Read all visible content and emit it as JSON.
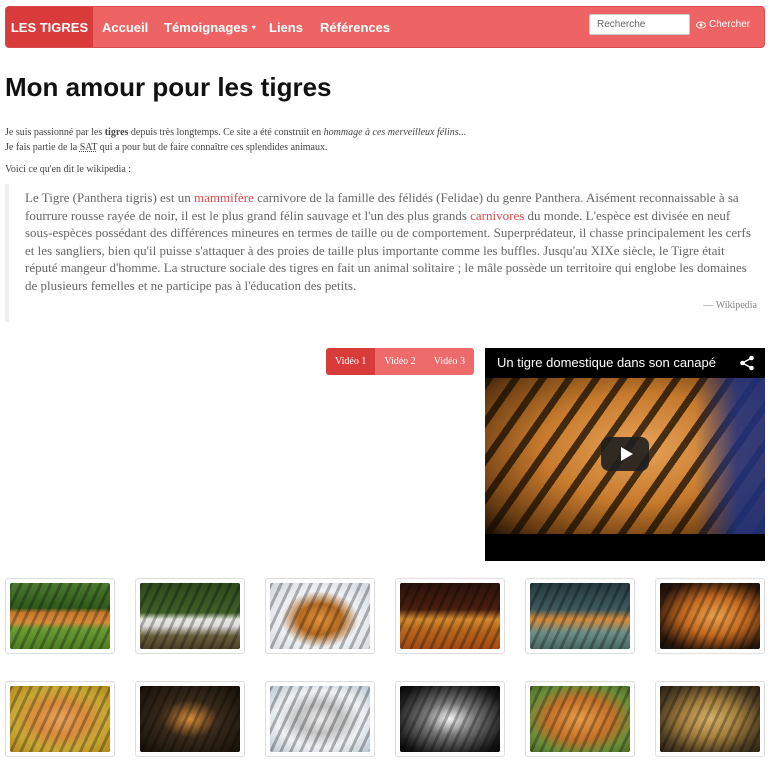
{
  "navbar": {
    "brand": "LES TIGRES",
    "items": [
      {
        "label": "Accueil"
      },
      {
        "label": "Témoignages"
      },
      {
        "label": "Liens"
      },
      {
        "label": "Références"
      }
    ],
    "caret": "▾",
    "search_placeholder": "Recherche",
    "search_button": "Chercher",
    "colors": {
      "bar": "#ee6363",
      "brand": "#d93a3a"
    }
  },
  "page_title": "Mon amour pour les tigres",
  "intro": {
    "line1_a": "Je suis passionné par les ",
    "line1_bold": "tigres",
    "line1_b": " depuis très longtemps. Ce site a été construit en ",
    "line1_italic": "hommage à ces merveilleux félins",
    "line1_c": "...",
    "line2_a": "Je fais partie de la ",
    "line2_abbr": "SAT",
    "line2_b": " qui a pour but de faire connaître ces splendides animaux.",
    "line3": "Voici ce qu'en dit le wikipedia :"
  },
  "quote": {
    "p1": "Le Tigre (Panthera tigris) est un ",
    "link1": "mammifère",
    "p2": " carnivore de la famille des félidés (Felidae) du genre Panthera. Aisément reconnaissable à sa fourrure rousse rayée de noir, il est le plus grand félin sauvage et l'un des plus grands ",
    "link2": "carnivores",
    "p3": " du monde. L'espèce est divisée en neuf sous-espèces possédant des différences mineures en termes de taille ou de comportement. Superprédateur, il chasse principalement les cerfs et les sangliers, bien qu'il puisse s'attaquer à des proies de taille plus importante comme les buffles. Jusqu'au XIXe siècle, le Tigre était réputé mangeur d'homme. La structure sociale des tigres en fait un animal solitaire ; le mâle possède un territoire qui englobe les domaines de plusieurs femelles et ne participe pas à l'éducation des petits.",
    "source": "— Wikipedia"
  },
  "video_tabs": [
    {
      "label": "Vidéo 1",
      "active": true
    },
    {
      "label": "Vidéo 2",
      "active": false
    },
    {
      "label": "Vidéo 3",
      "active": false
    }
  ],
  "video": {
    "title": "Un tigre domestique dans son canapé",
    "share_icon": "share-icon",
    "play_icon": "play-icon"
  },
  "gallery": {
    "rows": 2,
    "per_row": 6,
    "images": [
      "tiger-grass",
      "white-tiger-water",
      "tiger-snow",
      "tiger-field",
      "tiger-rocks",
      "tiger-face",
      "tiger-cub",
      "tiger-dark",
      "white-tiger-snow",
      "white-tiger-face",
      "tiger-roar",
      "jaguar-log"
    ]
  }
}
